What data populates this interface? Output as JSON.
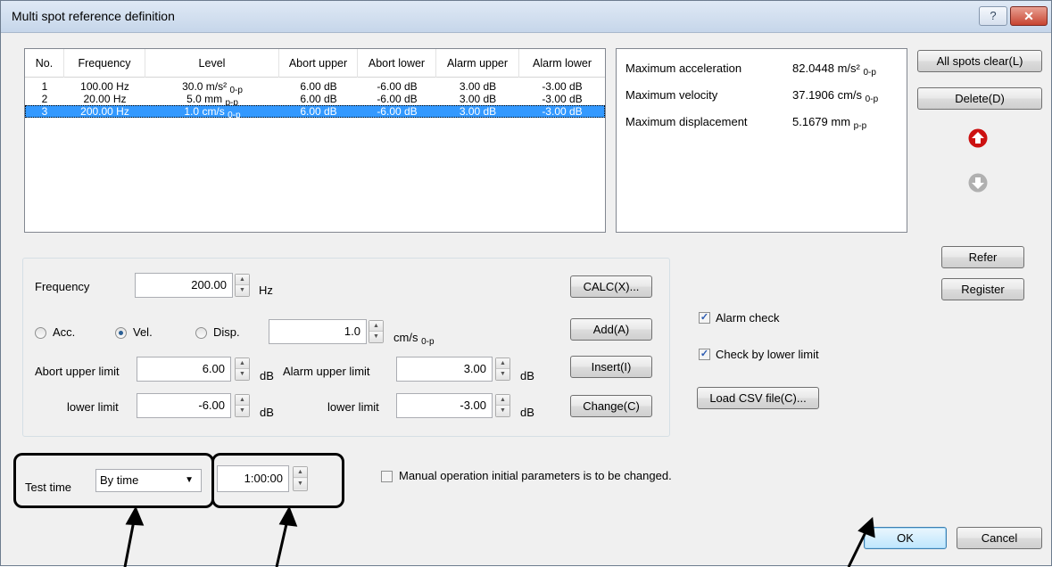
{
  "window": {
    "title": "Multi spot reference definition",
    "help_glyph": "?",
    "close_glyph": "✕"
  },
  "list": {
    "columns": [
      "No.",
      "Frequency",
      "Level",
      "Abort upper",
      "Abort lower",
      "Alarm upper",
      "Alarm lower"
    ],
    "rows": [
      {
        "no": "1",
        "freq": "100.00 Hz",
        "level": "30.0 m/s²",
        "level_sub": "0-p",
        "abort_upper": "6.00 dB",
        "abort_lower": "-6.00 dB",
        "alarm_upper": "3.00 dB",
        "alarm_lower": "-3.00 dB",
        "selected": false
      },
      {
        "no": "2",
        "freq": "20.00 Hz",
        "level": "5.0 mm",
        "level_sub": "p-p",
        "abort_upper": "6.00 dB",
        "abort_lower": "-6.00 dB",
        "alarm_upper": "3.00 dB",
        "alarm_lower": "-3.00 dB",
        "selected": false
      },
      {
        "no": "3",
        "freq": "200.00 Hz",
        "level": "1.0 cm/s",
        "level_sub": "0-p",
        "abort_upper": "6.00 dB",
        "abort_lower": "-6.00 dB",
        "alarm_upper": "3.00 dB",
        "alarm_lower": "-3.00 dB",
        "selected": true
      }
    ]
  },
  "info": {
    "acc_label": "Maximum acceleration",
    "acc_value": "82.0448 m/s²",
    "acc_sub": "0-p",
    "vel_label": "Maximum velocity",
    "vel_value": "37.1906 cm/s",
    "vel_sub": "0-p",
    "disp_label": "Maximum displacement",
    "disp_value": "5.1679 mm",
    "disp_sub": "p-p"
  },
  "buttons": {
    "all_clear": "All spots clear(L)",
    "delete": "Delete(D)",
    "refer": "Refer",
    "register": "Register",
    "calc": "CALC(X)...",
    "add": "Add(A)",
    "insert": "Insert(I)",
    "change": "Change(C)",
    "load_csv": "Load CSV file(C)...",
    "ok": "OK",
    "cancel": "Cancel"
  },
  "form": {
    "frequency_label": "Frequency",
    "frequency_value": "200.00",
    "frequency_unit": "Hz",
    "acc_label": "Acc.",
    "vel_label": "Vel.",
    "disp_label": "Disp.",
    "selected_mode": "Vel.",
    "level_value": "1.0",
    "level_unit": "cm/s",
    "level_unit_sub": "0-p",
    "abort_upper_label": "Abort upper limit",
    "abort_upper_value": "6.00",
    "abort_upper_unit": "dB",
    "abort_lower_label": "lower limit",
    "abort_lower_value": "-6.00",
    "abort_lower_unit": "dB",
    "alarm_upper_label": "Alarm upper limit",
    "alarm_upper_value": "3.00",
    "alarm_upper_unit": "dB",
    "alarm_lower_label": "lower limit",
    "alarm_lower_value": "-3.00",
    "alarm_lower_unit": "dB"
  },
  "checks": {
    "alarm_check": "Alarm check",
    "alarm_check_on": true,
    "lower_check": "Check by lower limit",
    "lower_check_on": true,
    "manual_check": "Manual operation initial parameters is to be changed.",
    "manual_check_on": false
  },
  "test_time": {
    "label": "Test time",
    "mode": "By time",
    "value": "1:00:00"
  },
  "colors": {
    "selection": "#3399ff",
    "arrow_active": "#cc1111",
    "arrow_disabled": "#b0b0b0"
  }
}
